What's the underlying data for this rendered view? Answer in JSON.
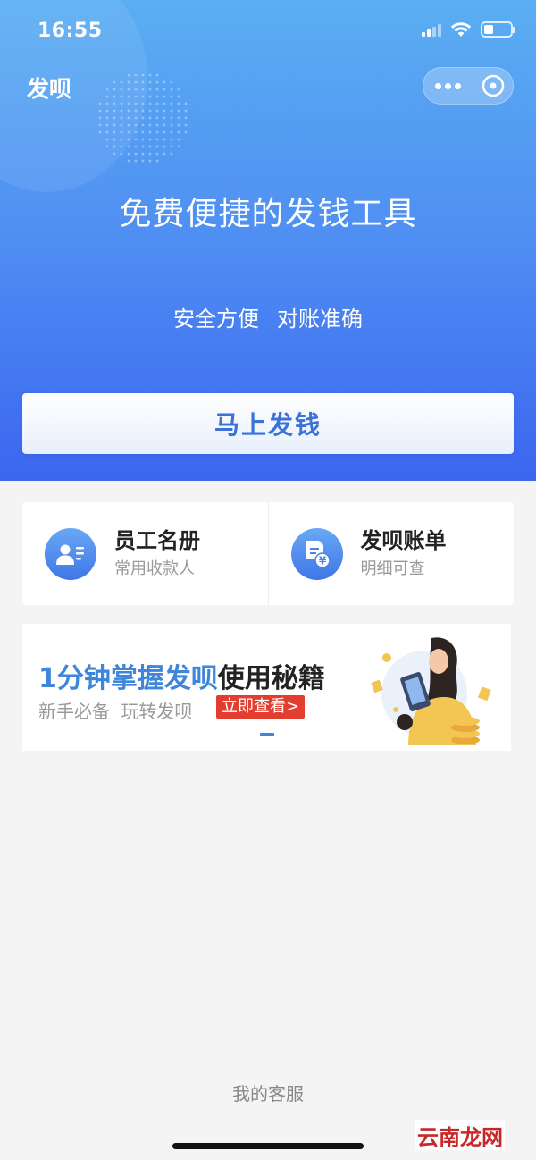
{
  "status_bar": {
    "time": "16:55"
  },
  "nav": {
    "title": "发呗"
  },
  "hero": {
    "title": "免费便捷的发钱工具",
    "tagline": [
      "安全方便",
      "对账准确"
    ],
    "cta_label": "马上发钱"
  },
  "entries": [
    {
      "title": "员工名册",
      "subtitle": "常用收款人",
      "icon": "employee-roster-icon"
    },
    {
      "title": "发呗账单",
      "subtitle": "明细可查",
      "icon": "bill-yuan-icon"
    }
  ],
  "banner": {
    "title_highlight": "1分钟掌握发呗",
    "title_rest": "使用秘籍",
    "subtitle": "新手必备 玩转发呗",
    "button_label": "立即查看>",
    "accent_color": "#3e86db",
    "button_color": "#e23d2f"
  },
  "footer": {
    "link_label": "我的客服"
  },
  "watermark": {
    "text": "云南龙网"
  },
  "colors": {
    "hero_top": "#5aaef2",
    "hero_bottom": "#3b66f0",
    "cta_text": "#3a72d8"
  }
}
